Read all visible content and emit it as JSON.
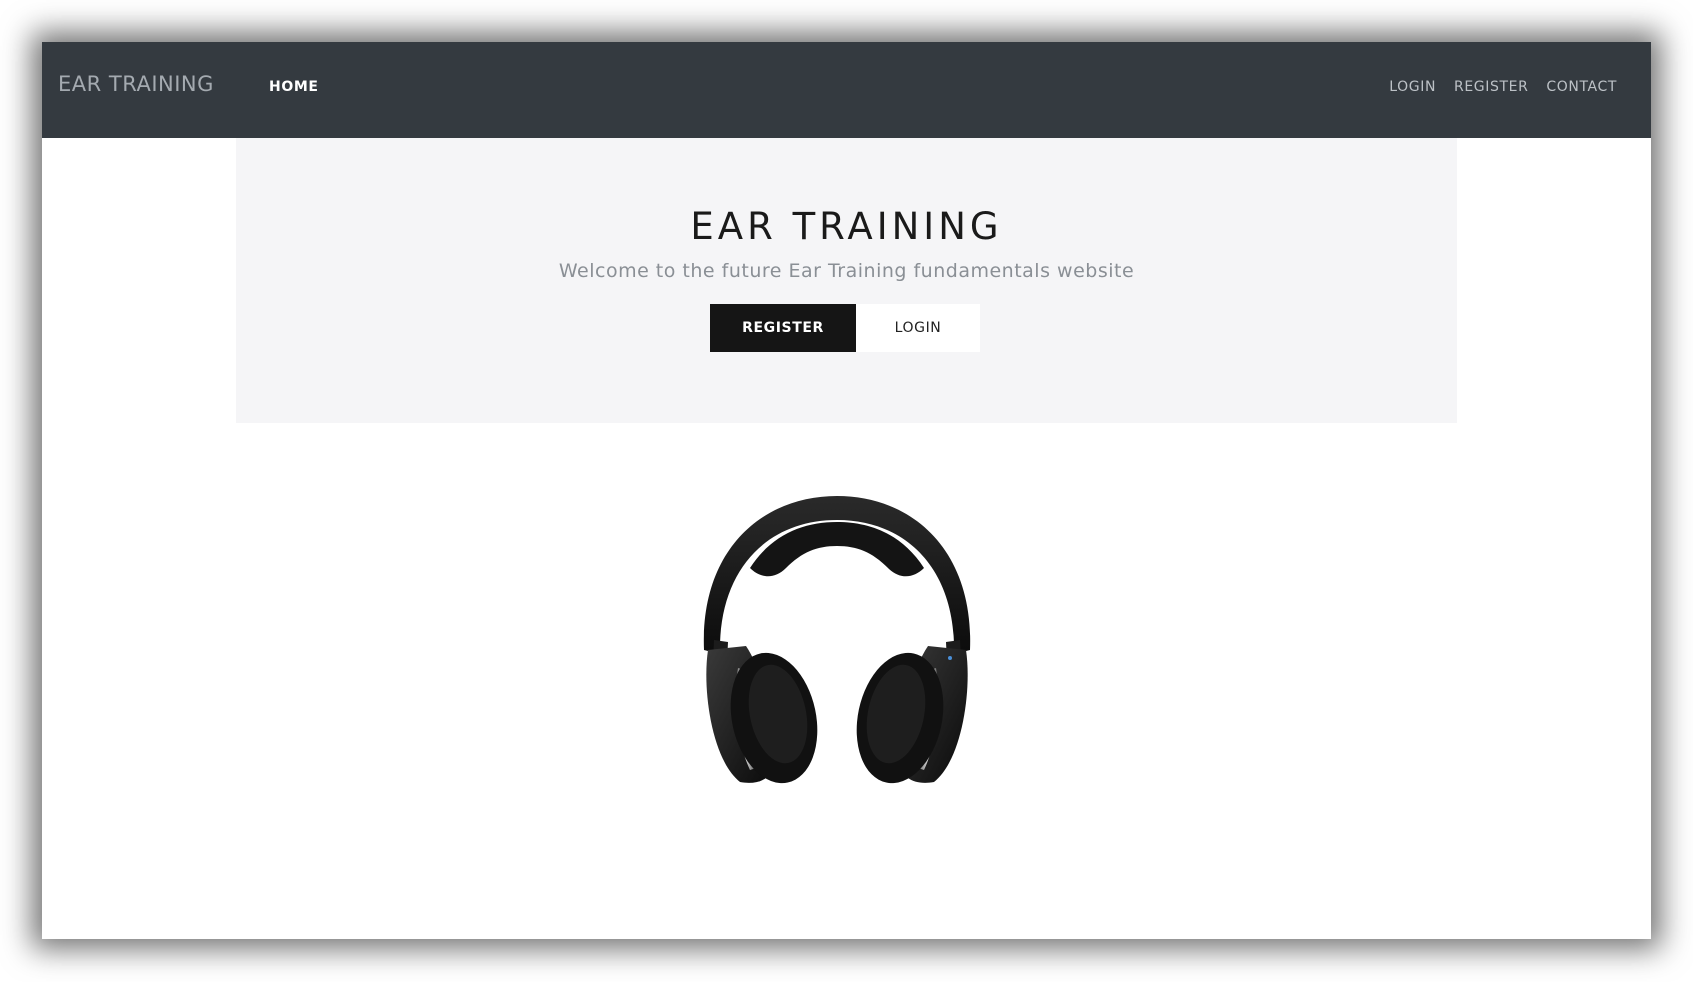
{
  "navbar": {
    "brand": "EAR TRAINING",
    "home_label": "HOME",
    "right_links": [
      "LOGIN",
      "REGISTER",
      "CONTACT"
    ]
  },
  "hero": {
    "title": "EAR TRAINING",
    "subtitle": "Welcome to the future Ear Training fundamentals website",
    "register_label": "REGISTER",
    "login_label": "LOGIN"
  },
  "image": {
    "icon": "headphones-icon"
  },
  "colors": {
    "navbar_bg": "#343a40",
    "hero_bg": "#f5f5f7",
    "primary_button": "#151515"
  }
}
